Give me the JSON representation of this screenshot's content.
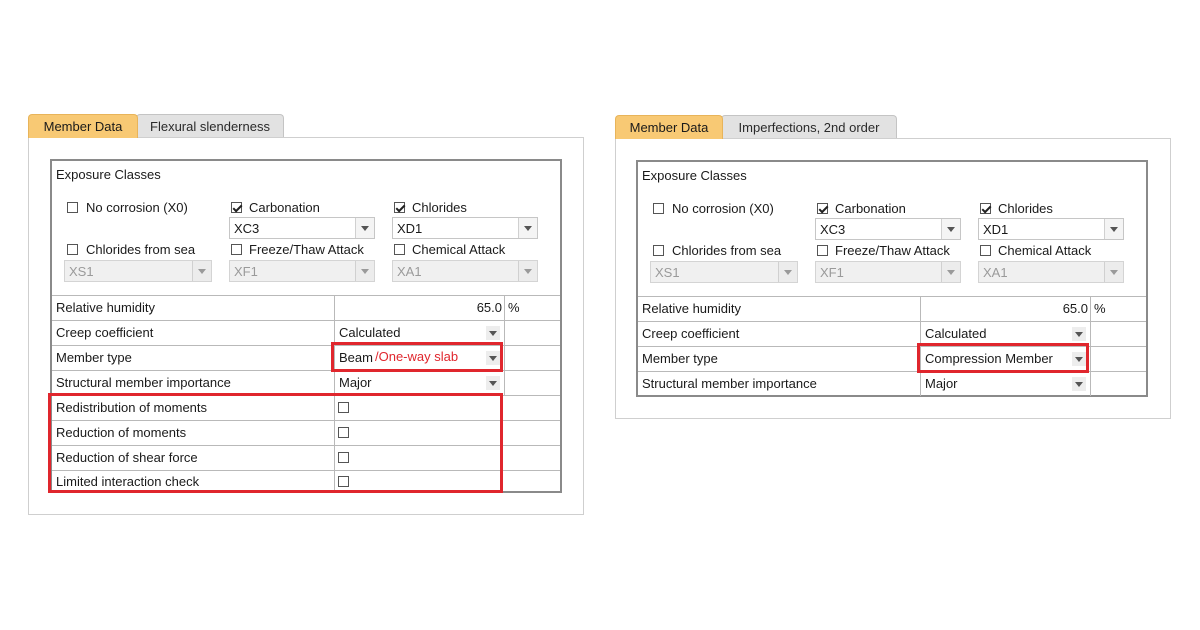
{
  "left": {
    "tabs": [
      "Member Data",
      "Flexural slenderness"
    ],
    "section_title": "Exposure Classes",
    "exposure": {
      "no_corrosion": {
        "label": "No corrosion (X0)",
        "checked": false
      },
      "carbonation": {
        "label": "Carbonation",
        "checked": true,
        "value": "XC3"
      },
      "chlorides": {
        "label": "Chlorides",
        "checked": true,
        "value": "XD1"
      },
      "chlorides_sea": {
        "label": "Chlorides from sea",
        "checked": false,
        "value": "XS1"
      },
      "freeze_thaw": {
        "label": "Freeze/Thaw Attack",
        "checked": false,
        "value": "XF1"
      },
      "chemical": {
        "label": "Chemical Attack",
        "checked": false,
        "value": "XA1"
      }
    },
    "rows": {
      "humidity": {
        "label": "Relative humidity",
        "value": "65.0",
        "unit": "%"
      },
      "creep": {
        "label": "Creep coefficient",
        "value": "Calculated"
      },
      "member_type": {
        "label": "Member type",
        "value": "Beam",
        "note": "/One-way slab"
      },
      "importance": {
        "label": "Structural member importance",
        "value": "Major"
      },
      "redistribution": {
        "label": "Redistribution of moments"
      },
      "reduction_moments": {
        "label": "Reduction of moments"
      },
      "reduction_shear": {
        "label": "Reduction of shear force"
      },
      "limited_interaction": {
        "label": "Limited interaction check"
      }
    }
  },
  "right": {
    "tabs": [
      "Member Data",
      "Imperfections, 2nd order"
    ],
    "section_title": "Exposure Classes",
    "exposure": {
      "no_corrosion": {
        "label": "No corrosion (X0)",
        "checked": false
      },
      "carbonation": {
        "label": "Carbonation",
        "checked": true,
        "value": "XC3"
      },
      "chlorides": {
        "label": "Chlorides",
        "checked": true,
        "value": "XD1"
      },
      "chlorides_sea": {
        "label": "Chlorides from sea",
        "checked": false,
        "value": "XS1"
      },
      "freeze_thaw": {
        "label": "Freeze/Thaw Attack",
        "checked": false,
        "value": "XF1"
      },
      "chemical": {
        "label": "Chemical Attack",
        "checked": false,
        "value": "XA1"
      }
    },
    "rows": {
      "humidity": {
        "label": "Relative humidity",
        "value": "65.0",
        "unit": "%"
      },
      "creep": {
        "label": "Creep coefficient",
        "value": "Calculated"
      },
      "member_type": {
        "label": "Member type",
        "value": "Compression Member"
      },
      "importance": {
        "label": "Structural member importance",
        "value": "Major"
      }
    }
  },
  "colors": {
    "highlight": "#e0262d",
    "active_tab": "#f8c974"
  }
}
